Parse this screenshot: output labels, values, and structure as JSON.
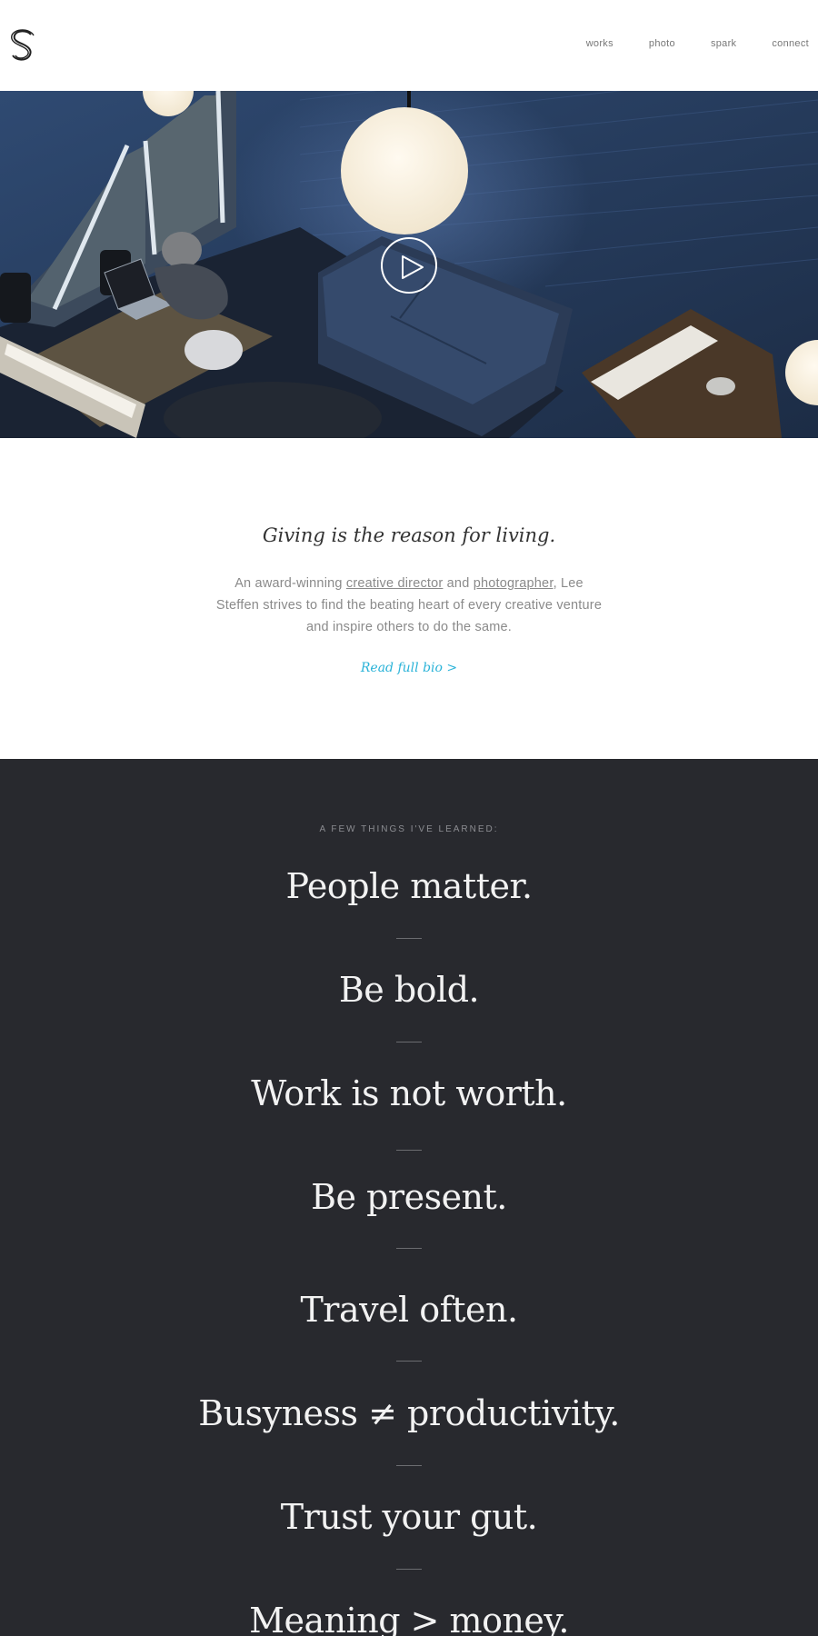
{
  "header": {
    "logo_alt": "S",
    "nav": [
      "works",
      "photo",
      "spark",
      "connect"
    ]
  },
  "hero": {
    "play_label": "Play video"
  },
  "intro": {
    "tagline": "Giving is the reason for living.",
    "bio_pre": "An award-winning ",
    "bio_link1": "creative director",
    "bio_mid": " and ",
    "bio_link2": "photographer",
    "bio_post": ", Lee Steffen strives to find the beating heart of every creative venture and inspire others to do the same.",
    "read_more": "Read full bio >"
  },
  "learned": {
    "kicker": "A FEW THINGS I'VE LEARNED:",
    "lessons": [
      "People matter.",
      "Be bold.",
      "Work is not worth.",
      "Be present.",
      "Travel often.",
      "Busyness ≠ productivity.",
      "Trust your gut.",
      "Meaning > money."
    ]
  },
  "colors": {
    "accent": "#2ab3d8",
    "dark_section": "#28292e",
    "text_muted": "#8a8a8a"
  }
}
